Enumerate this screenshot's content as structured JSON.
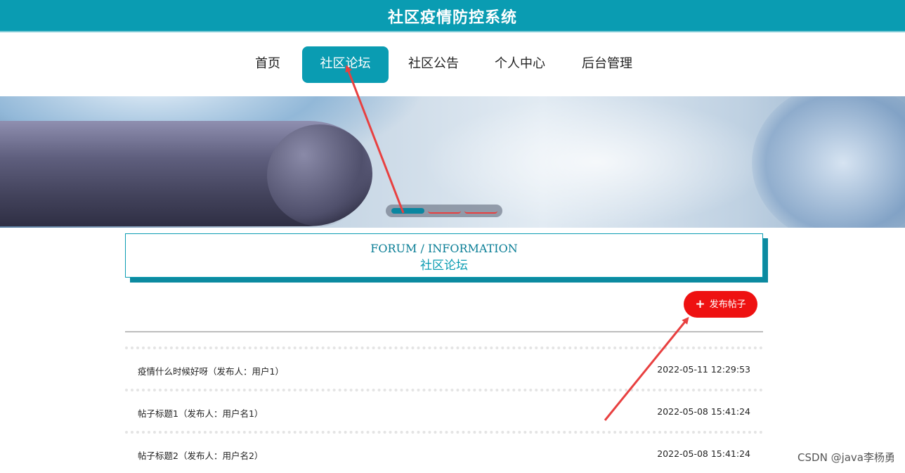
{
  "header": {
    "title": "社区疫情防控系统"
  },
  "nav": {
    "items": [
      {
        "label": "首页",
        "active": false
      },
      {
        "label": "社区论坛",
        "active": true
      },
      {
        "label": "社区公告",
        "active": false
      },
      {
        "label": "个人中心",
        "active": false
      },
      {
        "label": "后台管理",
        "active": false
      }
    ]
  },
  "carousel": {
    "slide_count": 3,
    "active_index": 0
  },
  "section": {
    "title_en": "FORUM / INFORMATION",
    "title_cn": "社区论坛"
  },
  "actions": {
    "publish_label": "发布帖子",
    "publish_icon": "plus-icon"
  },
  "posts": [
    {
      "title": "疫情什么时候好呀（发布人：用户1）",
      "time": "2022-05-11 12:29:53"
    },
    {
      "title": "帖子标题1（发布人：用户名1）",
      "time": "2022-05-08 15:41:24"
    },
    {
      "title": "帖子标题2（发布人：用户名2）",
      "time": "2022-05-08 15:41:24"
    }
  ],
  "watermark": "CSDN @java李杨勇",
  "colors": {
    "primary": "#0a9cb2",
    "publish_button": "#ee1111",
    "annotation_arrow": "#e84040"
  }
}
